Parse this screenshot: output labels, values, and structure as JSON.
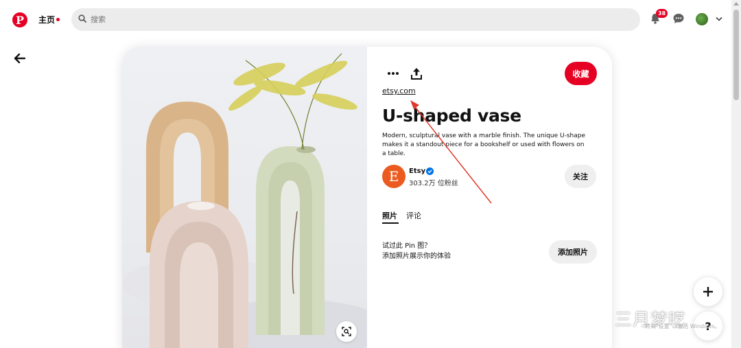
{
  "header": {
    "home_label": "主页",
    "search_placeholder": "搜索",
    "notification_count": "38"
  },
  "pin": {
    "source": "etsy.com",
    "title": "U-shaped vase",
    "description": "Modern, sculptural vase with a marble finish. The unique U-shape makes it a standout piece for a bookshelf or used with flowers on a table.",
    "save_label": "收藏",
    "creator": {
      "initial": "E",
      "name": "Etsy",
      "followers": "303.2万 位粉丝",
      "follow_label": "关注"
    },
    "tabs": [
      {
        "label": "照片",
        "active": true
      },
      {
        "label": "评论",
        "active": false
      }
    ],
    "try_prompt": {
      "line1": "试过此 Pin 图？",
      "line2": "添加照片展示你的体验",
      "button_label": "添加照片"
    }
  },
  "floating": {
    "help_label": "?"
  },
  "watermark": {
    "text": "三月梦呓",
    "sub": "转到\"设置\"以激活 Windows。"
  },
  "colors": {
    "brand": "#e60023",
    "creator_avatar": "#eb5a1e",
    "verified": "#0074e8",
    "annotation_arrow": "#e0382c"
  }
}
